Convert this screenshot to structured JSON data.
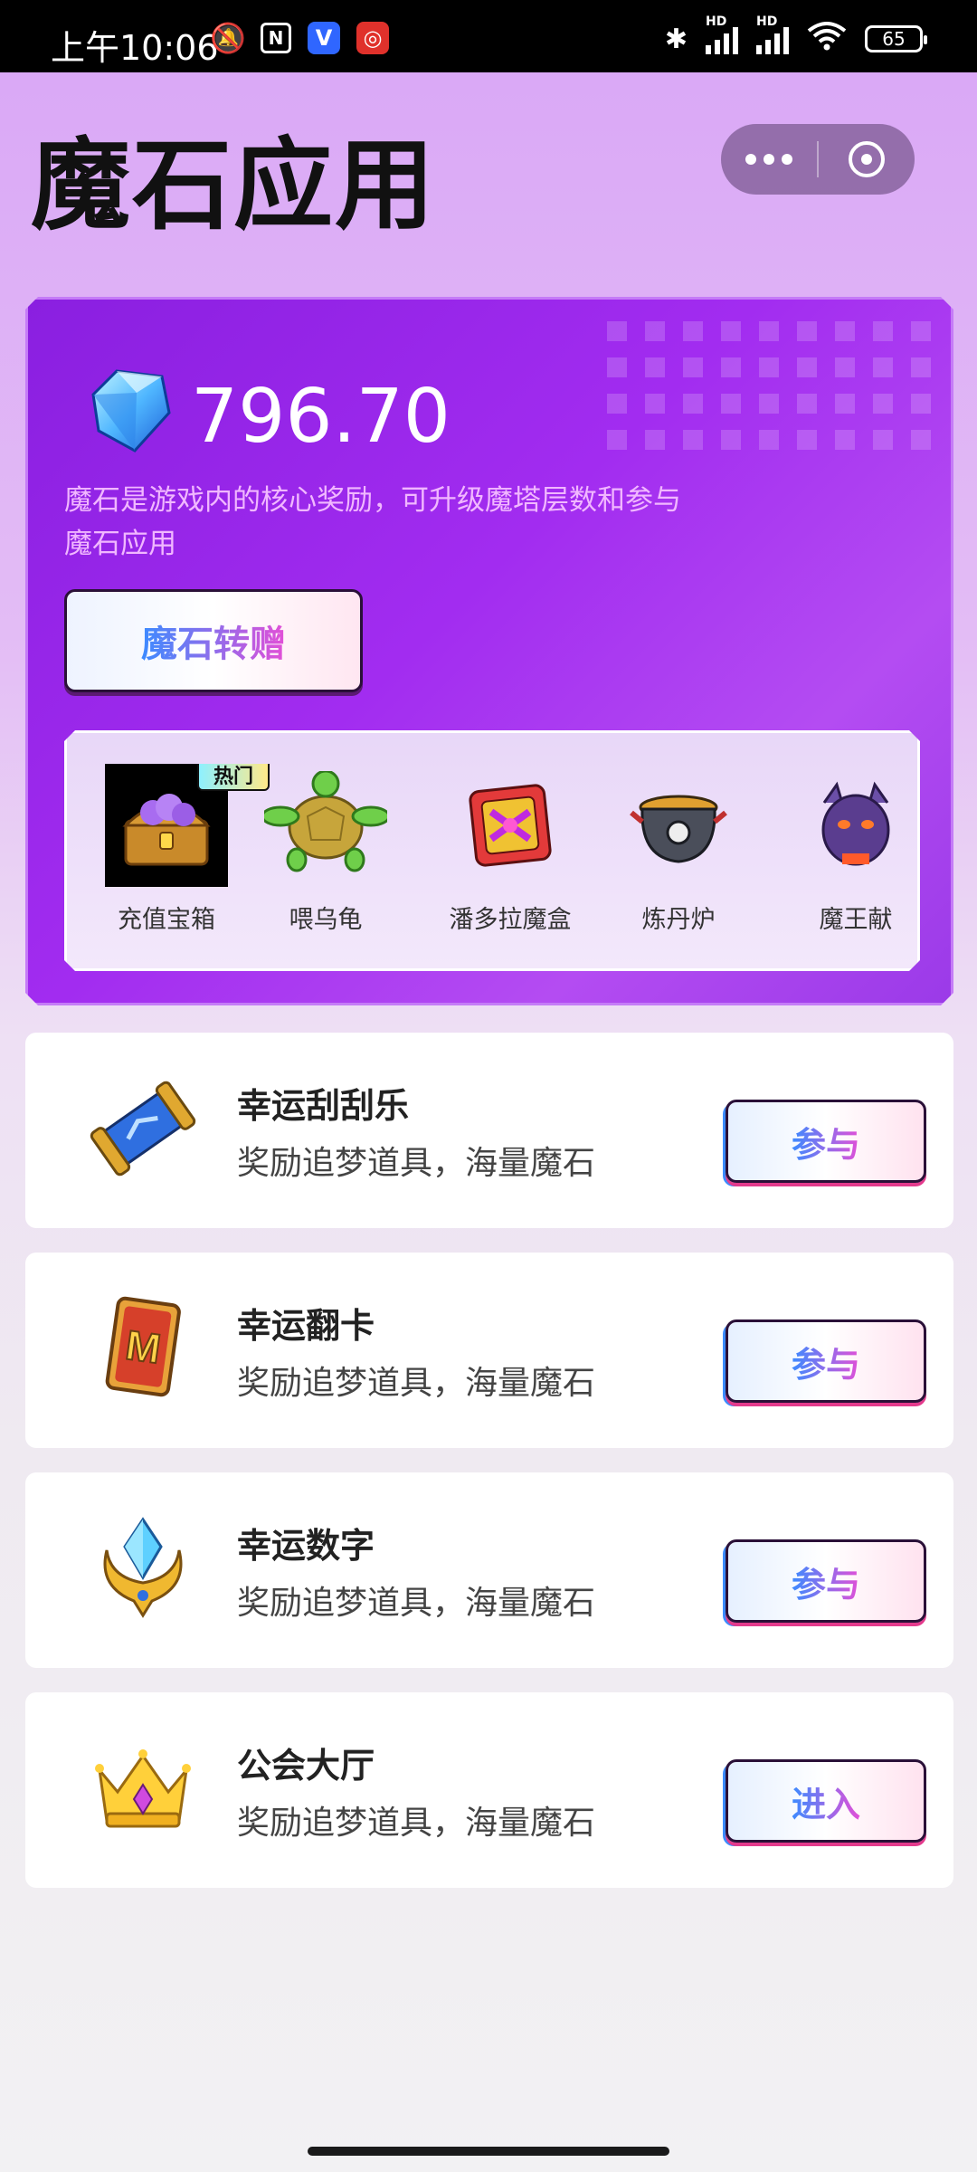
{
  "status_bar": {
    "time": "上午10:06",
    "battery": "65",
    "hd1": "HD",
    "hd2": "HD",
    "wifi_level": "6"
  },
  "header": {
    "title": "魔石应用"
  },
  "balance_card": {
    "amount": "796.70",
    "description": "魔石是游戏内的核心奖励，可升级魔塔层数和参与魔石应用",
    "gift_button": "魔石转赠",
    "apps": [
      {
        "label": "充值宝箱",
        "badge": "热门",
        "icon": "treasure-chest-icon"
      },
      {
        "label": "喂乌龟",
        "icon": "turtle-icon"
      },
      {
        "label": "潘多拉魔盒",
        "icon": "pandora-box-icon"
      },
      {
        "label": "炼丹炉",
        "icon": "cauldron-icon"
      },
      {
        "label": "魔王献",
        "icon": "demon-king-icon"
      }
    ]
  },
  "activities": [
    {
      "title": "幸运刮刮乐",
      "subtitle": "奖励追梦道具，海量魔石",
      "button": "参与",
      "icon": "scroll-icon"
    },
    {
      "title": "幸运翻卡",
      "subtitle": "奖励追梦道具，海量魔石",
      "button": "参与",
      "icon": "card-icon"
    },
    {
      "title": "幸运数字",
      "subtitle": "奖励追梦道具，海量魔石",
      "button": "参与",
      "icon": "crystal-emblem-icon"
    },
    {
      "title": "公会大厅",
      "subtitle": "奖励追梦道具，海量魔石",
      "button": "进入",
      "icon": "crown-icon"
    }
  ],
  "colors": {
    "card_primary": "#8a1fe0",
    "accent_blue": "#3c8bff",
    "accent_pink": "#e34fd7"
  }
}
